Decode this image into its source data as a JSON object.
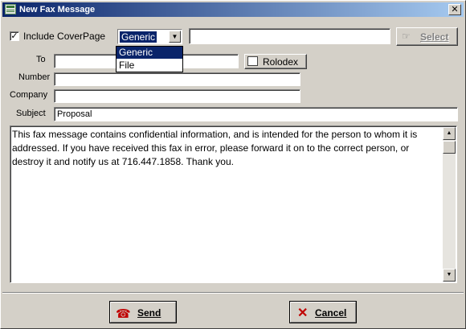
{
  "window": {
    "title": "New Fax Message",
    "close_glyph": "✕"
  },
  "coverpage": {
    "checkbox_label": "Include CoverPage",
    "checked_glyph": "✓",
    "combo_value": "Generic",
    "options": [
      "Generic",
      "File"
    ],
    "file_value": "",
    "select_label": "Select"
  },
  "fields": {
    "to_label": "To",
    "to_value": "",
    "rolodex_label": "Rolodex",
    "number_label": "Number",
    "number_value": "",
    "company_label": "Company",
    "company_value": "",
    "subject_label": "Subject",
    "subject_value": "Proposal"
  },
  "message": {
    "body": "This fax message contains confidential information, and is intended for the person to whom it is addressed.  If you have received this fax in error, please forward it on to the correct person, or destroy it and notify us at 716.447.1858.  Thank you."
  },
  "actions": {
    "send_label": "Send",
    "cancel_label": "Cancel"
  },
  "icons": {
    "window": "fax-window-icon",
    "select": "pointer-icon",
    "rolodex": "rolodex-icon",
    "send": "telephone-icon",
    "cancel": "x-icon"
  },
  "colors": {
    "title_start": "#0a246a",
    "title_end": "#a6caf0",
    "cancel_x": "#c00000",
    "send_phone": "#c00000"
  }
}
